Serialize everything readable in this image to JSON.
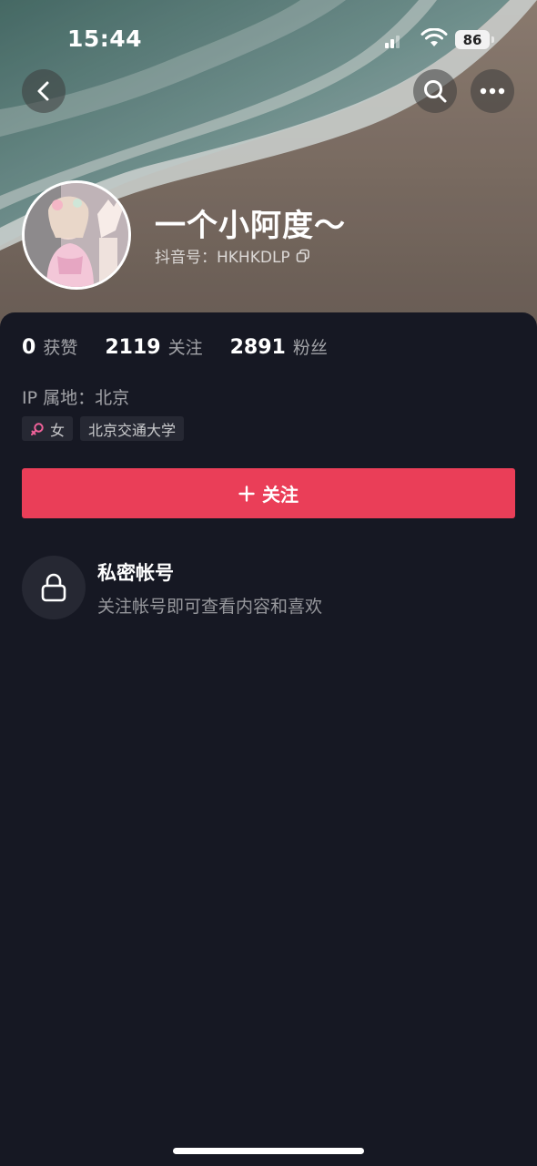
{
  "status_bar": {
    "time": "15:44",
    "battery": "86",
    "icons": [
      "signal-icon",
      "wifi-icon",
      "battery-icon"
    ]
  },
  "nav": {
    "icons": [
      "back-arrow-icon",
      "search-icon",
      "more-icon"
    ]
  },
  "profile": {
    "nickname": "一个小阿度～",
    "douyin_id": "抖音号：HKHKDLP",
    "copy_icon": "copy-icon"
  },
  "stats": [
    {
      "number": "0",
      "label": "获赞"
    },
    {
      "number": "2119",
      "label": "关注"
    },
    {
      "number": "2891",
      "label": "粉丝"
    }
  ],
  "ip_location": "IP 属地：北京",
  "tags": {
    "gender": {
      "icon": "female-icon",
      "label": "女"
    },
    "school": "北京交通大学"
  },
  "follow_button": {
    "icon": "plus-icon",
    "label": "关注"
  },
  "private_account": {
    "icon": "lock-icon",
    "title": "私密帐号",
    "description": "关注帐号即可查看内容和喜欢"
  },
  "colors": {
    "background": "#161823",
    "accent": "#ea3e58",
    "tag_bg": "#262833",
    "female": "#f0629a"
  }
}
